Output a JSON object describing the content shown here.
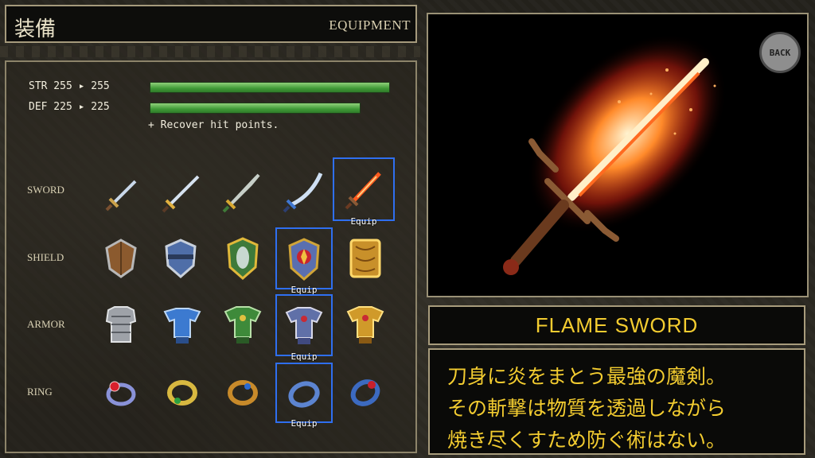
{
  "header": {
    "title_jp": "装備",
    "title_en": "EQUIPMENT"
  },
  "stats": [
    {
      "label": "STR 255 ▸ 255",
      "fill": 1.0
    },
    {
      "label": "DEF 225 ▸ 225",
      "fill": 0.88
    }
  ],
  "effect": "+ Recover hit points.",
  "rows": [
    {
      "label": "SWORD",
      "items": [
        "short-sword",
        "long-sword",
        "green-hilt-sword",
        "blue-scimitar",
        "flame-sword"
      ],
      "equipped": 4
    },
    {
      "label": "SHIELD",
      "items": [
        "wooden-shield",
        "iron-shield",
        "mirror-shield",
        "ruby-crest-shield",
        "gold-shield"
      ],
      "equipped": 3
    },
    {
      "label": "ARMOR",
      "items": [
        "chain-mail",
        "blue-plate-armor",
        "green-plate-armor",
        "steel-plate-armor",
        "gold-armor"
      ],
      "equipped": 3
    },
    {
      "label": "RING",
      "items": [
        "ruby-ring",
        "emerald-ring",
        "amber-ring",
        "sapphire-ring",
        "garnet-ring"
      ],
      "equipped": 3
    }
  ],
  "equip_label": "Equip",
  "back_label": "BACK",
  "item_name": "FLAME SWORD",
  "item_desc": [
    "刀身に炎をまとう最強の魔剣。",
    "その斬撃は物質を透過しながら",
    "焼き尽くすため防ぐ術はない。"
  ],
  "colors": {
    "name_text": "#f3cc30",
    "selection": "#2f6ff0",
    "bar": "#5bb44d"
  }
}
